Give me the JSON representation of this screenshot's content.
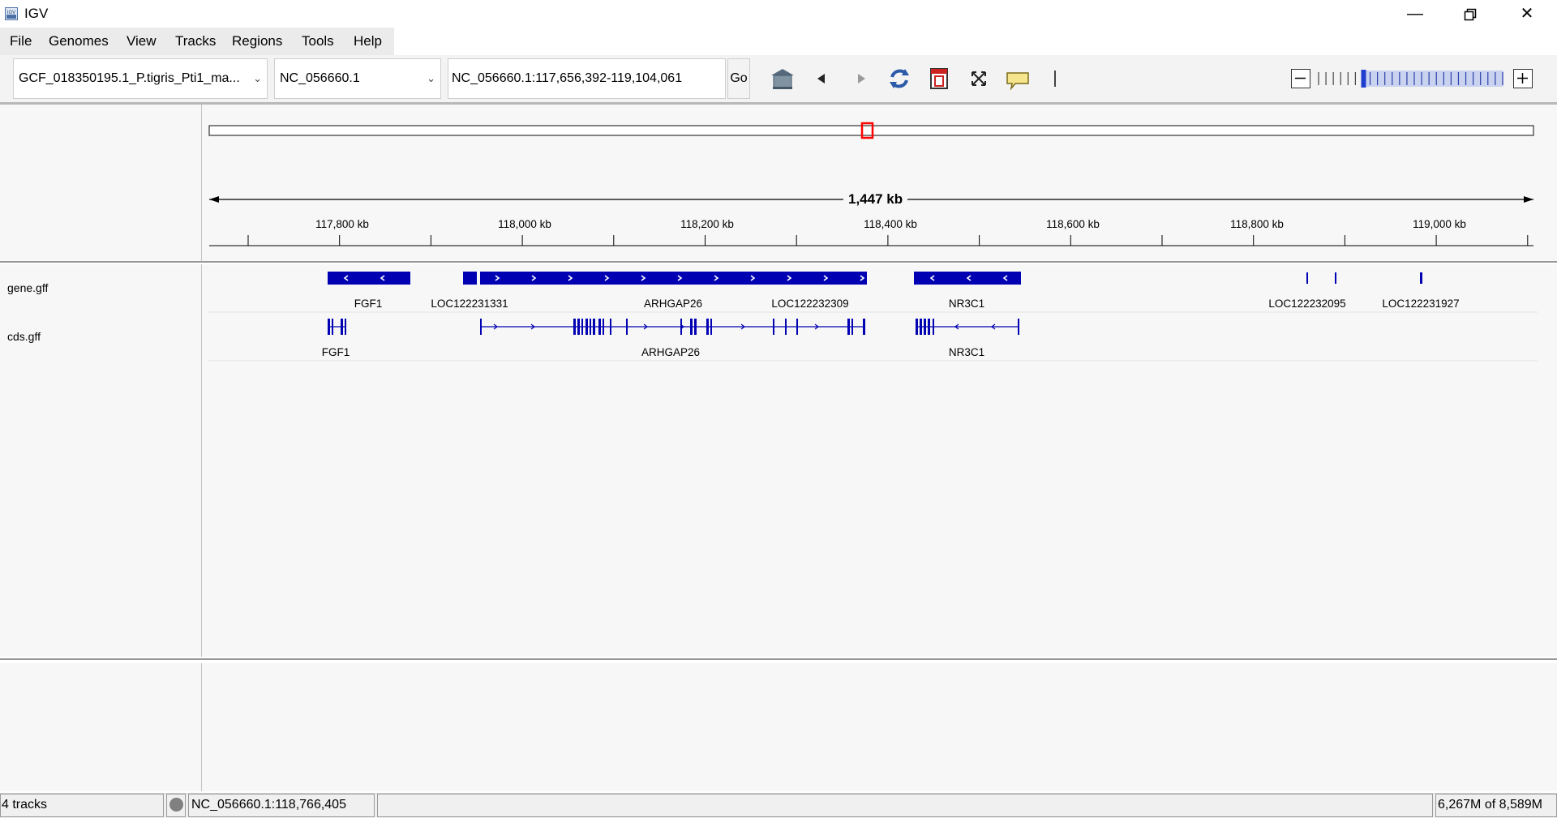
{
  "window": {
    "title": "IGV",
    "controls": [
      "minimize",
      "restore",
      "close"
    ]
  },
  "menu": [
    "File",
    "Genomes",
    "View",
    "Tracks",
    "Regions",
    "Tools",
    "Help"
  ],
  "toolbar": {
    "genome": "GCF_018350195.1_P.tigris_Pti1_ma...",
    "chromosome": "NC_056660.1",
    "locus": "NC_056660.1:117,656,392-119,104,061",
    "go_label": "Go",
    "tools": [
      "home-icon",
      "back-icon",
      "forward-icon",
      "refresh-icon",
      "roi-icon",
      "fit-icon",
      "popup-info-icon",
      "ruler-line-icon"
    ],
    "zoom": {
      "levels": 26,
      "current": 7
    }
  },
  "ruler": {
    "span_label": "1,447 kb",
    "ticks": [
      {
        "label": "117,800 kb"
      },
      {
        "label": "118,000 kb"
      },
      {
        "label": "118,200 kb"
      },
      {
        "label": "118,400 kb"
      },
      {
        "label": "118,600 kb"
      },
      {
        "label": "118,800 kb"
      },
      {
        "label": "119,000 kb"
      }
    ],
    "chromosome_view": "red box marks current region on ideogram"
  },
  "tracks": [
    {
      "name": "gene.gff",
      "features": [
        {
          "label": "FGF1"
        },
        {
          "label": "LOC122231331"
        },
        {
          "label": "ARHGAP26"
        },
        {
          "label": "LOC122232309"
        },
        {
          "label": "NR3C1"
        },
        {
          "label": "LOC122232095"
        },
        {
          "label": "LOC122231927"
        }
      ]
    },
    {
      "name": "cds.gff",
      "features": [
        {
          "label": "FGF1"
        },
        {
          "label": "ARHGAP26"
        },
        {
          "label": "NR3C1"
        }
      ]
    }
  ],
  "colors": {
    "feature": "#0000b2",
    "ideogram_box": "#ff0000",
    "panel_bg": "#f7f7f7"
  },
  "status": {
    "tracks": "4 tracks",
    "position": "NC_056660.1:118,766,405",
    "memory": "6,267M of 8,589M"
  }
}
